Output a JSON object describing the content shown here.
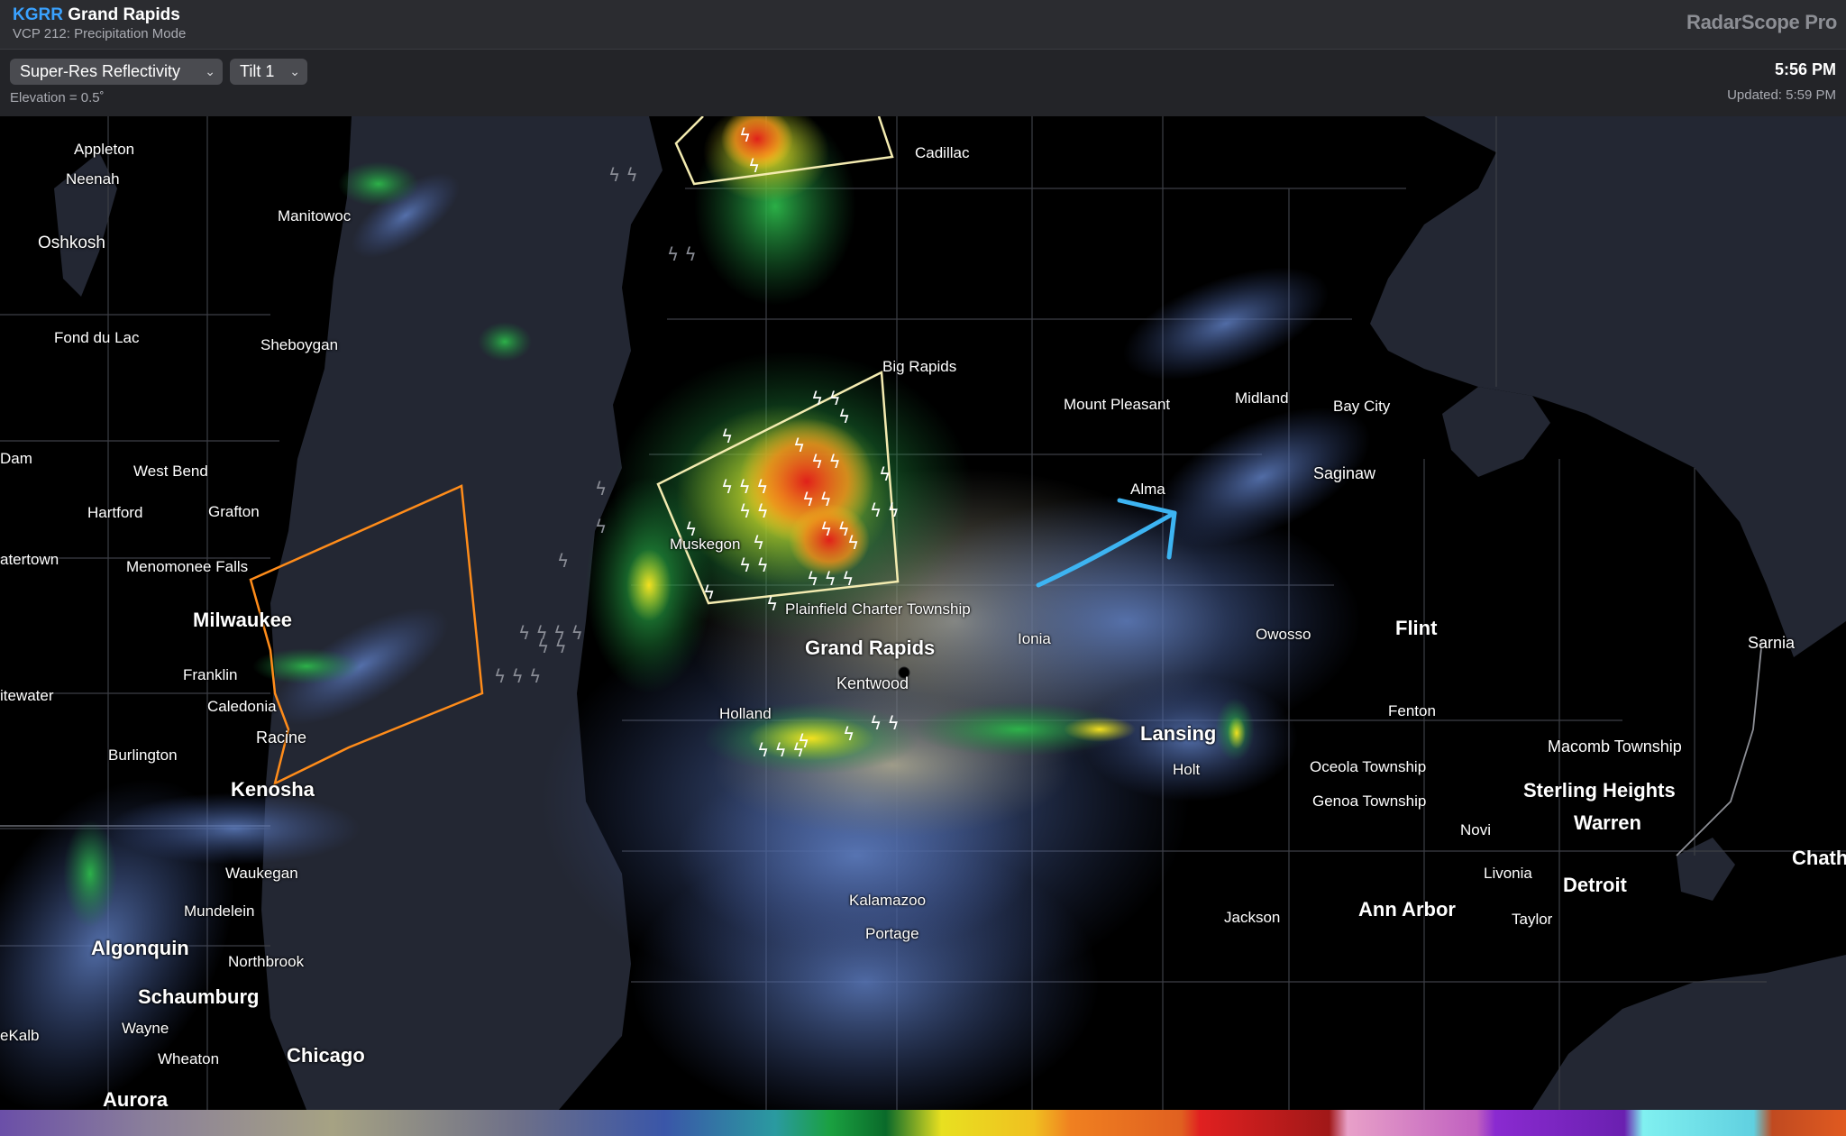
{
  "header": {
    "station_code": "KGRR",
    "station_name": "Grand Rapids",
    "vcp": "VCP 212: Precipitation Mode",
    "brand": "RadarScope Pro"
  },
  "toolbar": {
    "product": "Super-Res Reflectivity",
    "tilt": "Tilt 1",
    "elevation": "Elevation = 0.5˚",
    "time": "5:56 PM",
    "updated": "Updated: 5:59 PM"
  },
  "icons": {
    "chevron": "chevron-down-icon",
    "lightning": "lightning-bolt-icon",
    "annotation": "hand-drawn-arrow-icon",
    "radar_site": "radar-site-dot-icon"
  },
  "colors": {
    "warning_polygon_orange": "#ff8c1a",
    "warning_polygon_yellow": "#f3ebb0",
    "annotation_arrow": "#3db4f2",
    "lake": "#232733",
    "land": "#000000"
  },
  "cities": {
    "appleton": "Appleton",
    "neenah": "Neenah",
    "oshkosh": "Oshkosh",
    "manitowoc": "Manitowoc",
    "fond_du_lac": "Fond du Lac",
    "sheboygan": "Sheboygan",
    "dam": "Dam",
    "west_bend": "West Bend",
    "hartford": "Hartford",
    "grafton": "Grafton",
    "watertown": "atertown",
    "menomonee_falls": "Menomonee Falls",
    "milwaukee": "Milwaukee",
    "franklin": "Franklin",
    "caledonia": "Caledonia",
    "whitewater": "itewater",
    "racine": "Racine",
    "burlington": "Burlington",
    "kenosha": "Kenosha",
    "waukegan": "Waukegan",
    "mundelein": "Mundelein",
    "algonquin": "Algonquin",
    "northbrook": "Northbrook",
    "schaumburg": "Schaumburg",
    "wayne": "Wayne",
    "dekalb": "eKalb",
    "wheaton": "Wheaton",
    "chicago": "Chicago",
    "aurora": "Aurora",
    "cadillac": "Cadillac",
    "big_rapids": "Big Rapids",
    "mount_pleasant": "Mount Pleasant",
    "midland": "Midland",
    "bay_city": "Bay City",
    "saginaw": "Saginaw",
    "alma": "Alma",
    "muskegon": "Muskegon",
    "plainfield": "Plainfield Charter Township",
    "grand_rapids": "Grand Rapids",
    "ionia": "Ionia",
    "kentwood": "Kentwood",
    "owosso": "Owosso",
    "flint": "Flint",
    "sarnia": "Sarnia",
    "holland": "Holland",
    "fenton": "Fenton",
    "lansing": "Lansing",
    "holt": "Holt",
    "macomb": "Macomb Township",
    "oceola": "Oceola Township",
    "sterling_heights": "Sterling Heights",
    "genoa": "Genoa Township",
    "novi": "Novi",
    "warren": "Warren",
    "chatham": "Chath",
    "livonia": "Livonia",
    "detroit": "Detroit",
    "kalamazoo": "Kalamazoo",
    "jackson": "Jackson",
    "ann_arbor": "Ann Arbor",
    "taylor": "Taylor",
    "portage": "Portage"
  }
}
